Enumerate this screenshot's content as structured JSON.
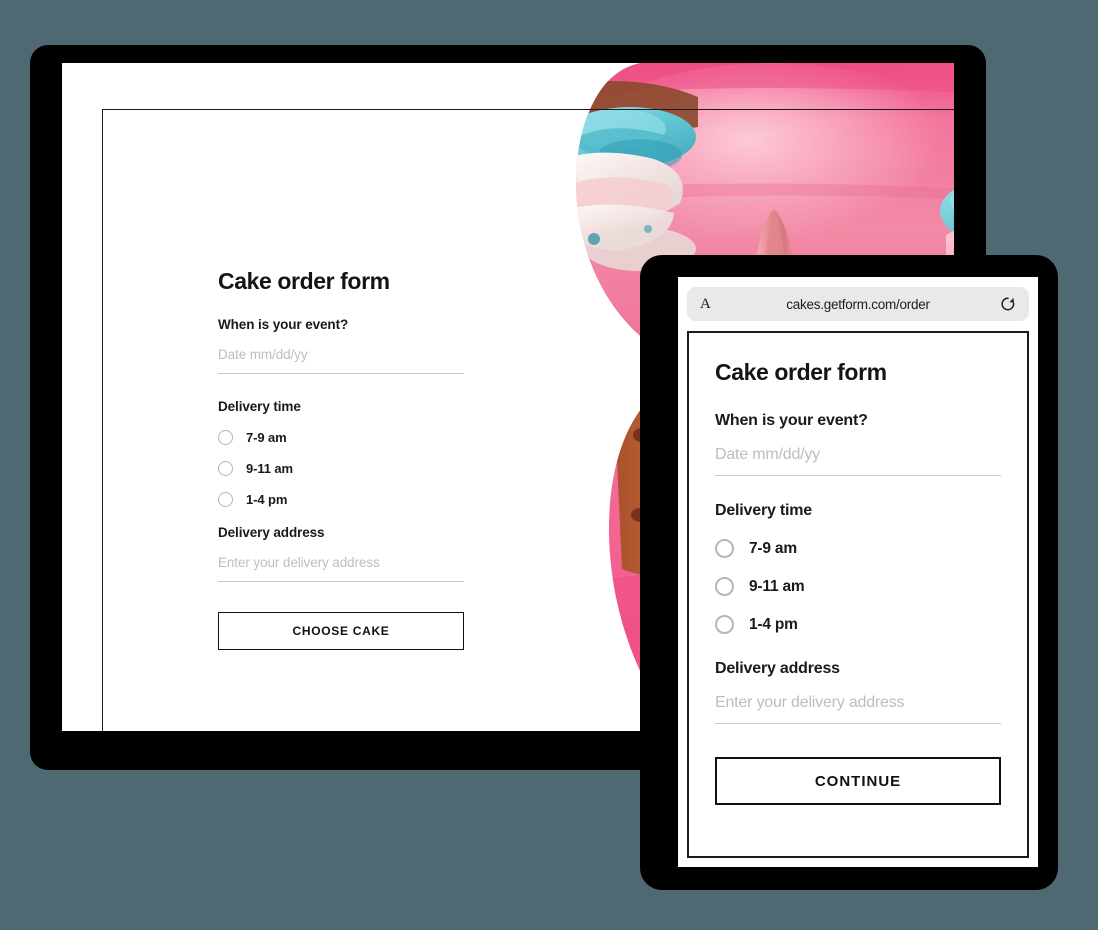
{
  "background_color": "#4f6973",
  "desktop": {
    "device_name": "laptop-mockup",
    "bezel_color": "#000000",
    "form": {
      "title": "Cake order form",
      "event_label": "When is your event?",
      "date_placeholder": "Date mm/dd/yy",
      "delivery_time_label": "Delivery time",
      "time_options": [
        {
          "label": "7-9 am",
          "selected": false
        },
        {
          "label": "9-11 am",
          "selected": false
        },
        {
          "label": "1-4 pm",
          "selected": false
        }
      ],
      "address_label": "Delivery address",
      "address_placeholder": "Enter your delivery address",
      "submit_label": "CHOOSE CAKE"
    }
  },
  "tablet": {
    "device_name": "tablet-mockup",
    "bezel_color": "#000000",
    "browser": {
      "text_size_icon": "aa-text-size-icon",
      "text_size_label": "A",
      "url": "cakes.getform.com/order",
      "reload_icon": "refresh-icon",
      "url_pill_color": "#e9e9eb"
    },
    "form": {
      "title": "Cake order form",
      "event_label": "When is your event?",
      "date_placeholder": "Date mm/dd/yy",
      "delivery_time_label": "Delivery time",
      "time_options": [
        {
          "label": "7-9 am",
          "selected": false
        },
        {
          "label": "9-11 am",
          "selected": false
        },
        {
          "label": "1-4 pm",
          "selected": false
        }
      ],
      "address_label": "Delivery address",
      "address_placeholder": "Enter your delivery address",
      "submit_label": "CONTINUE"
    }
  },
  "photo": {
    "name": "cupcakes-photo",
    "description": "Pink and blue frosted cupcakes on a pink background",
    "shape": "leaf-petal-mask",
    "palette": {
      "pink_bg": "#f2628f",
      "pink_cake": "#f07ba0",
      "deep_pink": "#ec4f85",
      "cream": "#f6dfe1",
      "teal": "#7fd4dd",
      "teal_deep": "#45b9c9",
      "orange": "#d9743a",
      "gold": "#e8b14e",
      "brown": "#9c4b2a"
    }
  }
}
